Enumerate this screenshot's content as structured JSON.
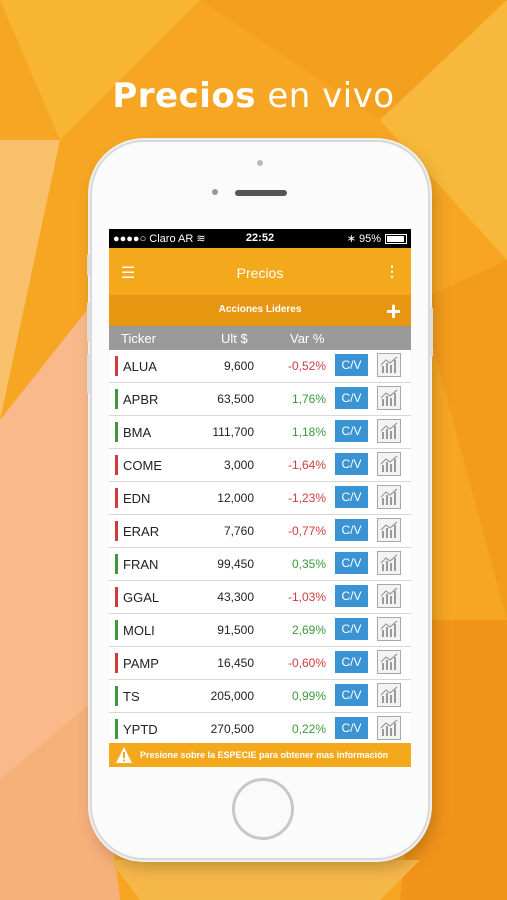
{
  "headline": {
    "bold": "Precios",
    "rest": " en vivo"
  },
  "status_bar": {
    "carrier": "Claro AR",
    "time": "22:52",
    "battery": "95%"
  },
  "app_bar": {
    "title": "Precios",
    "menu_icon": "hamburger-icon",
    "more_icon": "vertical-dots-icon"
  },
  "sub_bar": {
    "title": "Acciones Lideres",
    "add_icon": "plus-icon"
  },
  "columns": {
    "ticker": "Ticker",
    "last": "Ult $",
    "var": "Var %"
  },
  "rows": [
    {
      "ticker": "ALUA",
      "price": "9,600",
      "var": "-0,52%",
      "trend": "down"
    },
    {
      "ticker": "APBR",
      "price": "63,500",
      "var": "1,76%",
      "trend": "up"
    },
    {
      "ticker": "BMA",
      "price": "111,700",
      "var": "1,18%",
      "trend": "up"
    },
    {
      "ticker": "COME",
      "price": "3,000",
      "var": "-1,64%",
      "trend": "down"
    },
    {
      "ticker": "EDN",
      "price": "12,000",
      "var": "-1,23%",
      "trend": "down"
    },
    {
      "ticker": "ERAR",
      "price": "7,760",
      "var": "-0,77%",
      "trend": "down"
    },
    {
      "ticker": "FRAN",
      "price": "99,450",
      "var": "0,35%",
      "trend": "up"
    },
    {
      "ticker": "GGAL",
      "price": "43,300",
      "var": "-1,03%",
      "trend": "down"
    },
    {
      "ticker": "MOLI",
      "price": "91,500",
      "var": "2,69%",
      "trend": "up"
    },
    {
      "ticker": "PAMP",
      "price": "16,450",
      "var": "-0,60%",
      "trend": "down"
    },
    {
      "ticker": "TS",
      "price": "205,000",
      "var": "0,99%",
      "trend": "up"
    },
    {
      "ticker": "YPTD",
      "price": "270,500",
      "var": "0,22%",
      "trend": "up"
    }
  ],
  "cv_label": "C/V",
  "footer": {
    "text": "Presione sobre la ESPECIE para obtener mas información",
    "icon": "warning-icon"
  },
  "colors": {
    "up": "#3c9a3c",
    "down": "#d23b3b",
    "accent": "#f4a81c",
    "button": "#3a93d2"
  }
}
